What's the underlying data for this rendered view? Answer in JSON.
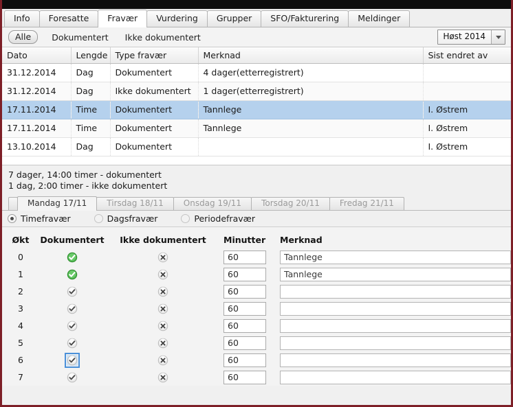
{
  "window": {
    "title_bar_color": "#0d0d0d",
    "border_color": "#7d1f27"
  },
  "tabs": [
    {
      "label": "Info",
      "active": false
    },
    {
      "label": "Foresatte",
      "active": false
    },
    {
      "label": "Fravær",
      "active": true
    },
    {
      "label": "Vurdering",
      "active": false
    },
    {
      "label": "Grupper",
      "active": false
    },
    {
      "label": "SFO/Fakturering",
      "active": false
    },
    {
      "label": "Meldinger",
      "active": false
    }
  ],
  "filter": {
    "links": [
      {
        "label": "Alle",
        "selected": true
      },
      {
        "label": "Dokumentert",
        "selected": false
      },
      {
        "label": "Ikke dokumentert",
        "selected": false
      }
    ],
    "term_select": {
      "value": "Høst 2014",
      "icon": "chevron-down-icon"
    }
  },
  "absence_table": {
    "columns": [
      "Dato",
      "Lengde",
      "Type fravær",
      "Merknad",
      "Sist endret av"
    ],
    "rows": [
      {
        "dato": "31.12.2014",
        "lengde": "Dag",
        "type": "Dokumentert",
        "merknad": "4 dager(etterregistrert)",
        "sist_endret_av": "",
        "selected": false
      },
      {
        "dato": "31.12.2014",
        "lengde": "Dag",
        "type": "Ikke dokumentert",
        "merknad": "1 dager(etterregistrert)",
        "sist_endret_av": "",
        "selected": false
      },
      {
        "dato": "17.11.2014",
        "lengde": "Time",
        "type": "Dokumentert",
        "merknad": "Tannlege",
        "sist_endret_av": "I. Østrem",
        "selected": true
      },
      {
        "dato": "17.11.2014",
        "lengde": "Time",
        "type": "Dokumentert",
        "merknad": "Tannlege",
        "sist_endret_av": "I. Østrem",
        "selected": false
      },
      {
        "dato": "13.10.2014",
        "lengde": "Dag",
        "type": "Dokumentert",
        "merknad": "",
        "sist_endret_av": "I. Østrem",
        "selected": false
      }
    ]
  },
  "summary": {
    "line1": "7 dager, 14:00 timer - dokumentert",
    "line2": "1 dag, 2:00 timer - ikke dokumentert"
  },
  "day_tabs": [
    {
      "label": "Mandag 17/11",
      "active": true,
      "disabled": false
    },
    {
      "label": "Tirsdag 18/11",
      "active": false,
      "disabled": true
    },
    {
      "label": "Onsdag 19/11",
      "active": false,
      "disabled": true
    },
    {
      "label": "Torsdag 20/11",
      "active": false,
      "disabled": true
    },
    {
      "label": "Fredag 21/11",
      "active": false,
      "disabled": true
    }
  ],
  "absence_type_radios": [
    {
      "label": "Timefravær",
      "checked": true,
      "disabled": false
    },
    {
      "label": "Dagsfravær",
      "checked": false,
      "disabled": true
    },
    {
      "label": "Periodefravær",
      "checked": false,
      "disabled": true
    }
  ],
  "okt_grid": {
    "columns": [
      "Økt",
      "Dokumentert",
      "Ikke dokumentert",
      "Minutter",
      "Merknad"
    ],
    "rows": [
      {
        "okt": "0",
        "dokumentert_state": "green-check-icon",
        "ikke_dokumentert_state": "grey-cross-icon",
        "minutter": "60",
        "merknad": "Tannlege",
        "focused": false
      },
      {
        "okt": "1",
        "dokumentert_state": "green-check-icon",
        "ikke_dokumentert_state": "grey-cross-icon",
        "minutter": "60",
        "merknad": "Tannlege",
        "focused": false
      },
      {
        "okt": "2",
        "dokumentert_state": "grey-check-icon",
        "ikke_dokumentert_state": "grey-cross-icon",
        "minutter": "60",
        "merknad": "",
        "focused": false
      },
      {
        "okt": "3",
        "dokumentert_state": "grey-check-icon",
        "ikke_dokumentert_state": "grey-cross-icon",
        "minutter": "60",
        "merknad": "",
        "focused": false
      },
      {
        "okt": "4",
        "dokumentert_state": "grey-check-icon",
        "ikke_dokumentert_state": "grey-cross-icon",
        "minutter": "60",
        "merknad": "",
        "focused": false
      },
      {
        "okt": "5",
        "dokumentert_state": "grey-check-icon",
        "ikke_dokumentert_state": "grey-cross-icon",
        "minutter": "60",
        "merknad": "",
        "focused": false
      },
      {
        "okt": "6",
        "dokumentert_state": "grey-check-icon",
        "ikke_dokumentert_state": "grey-cross-icon",
        "minutter": "60",
        "merknad": "",
        "focused": true
      },
      {
        "okt": "7",
        "dokumentert_state": "grey-check-icon",
        "ikke_dokumentert_state": "grey-cross-icon",
        "minutter": "60",
        "merknad": "",
        "focused": false
      }
    ]
  },
  "colors": {
    "selection_blue": "#b5d1ed",
    "focus_blue": "#4a90d9",
    "green_icon": "#3fa23f",
    "grey_icon": "#9b9b9b",
    "window_border": "#7d1f27"
  }
}
